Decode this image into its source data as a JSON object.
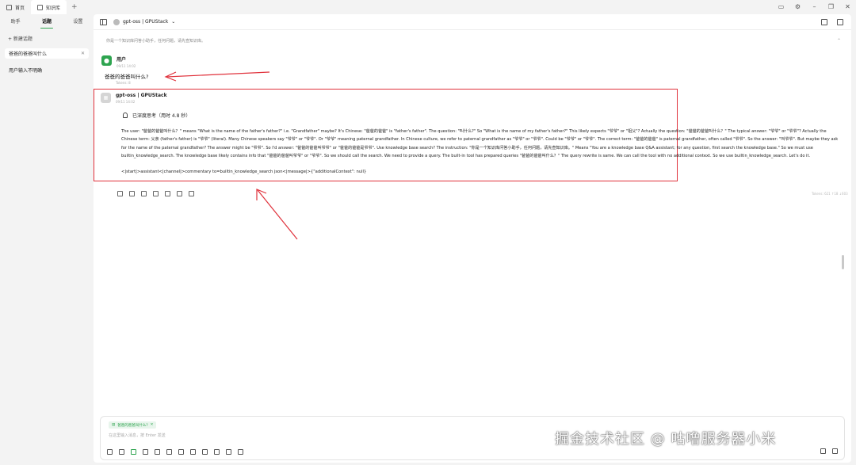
{
  "top_tabs": [
    {
      "label": "首页"
    },
    {
      "label": "知识库"
    }
  ],
  "sidebar": {
    "tabs": [
      {
        "label": "助手"
      },
      {
        "label": "话题"
      },
      {
        "label": "设置"
      }
    ],
    "new_topic": "+ 新建话题",
    "topics": [
      {
        "label": "爸爸的爸爸叫什么"
      },
      {
        "label": "用户输入不明确"
      }
    ]
  },
  "header": {
    "model": "gpt-oss | GPUStack"
  },
  "conversation": {
    "system_prompt": "你是一个知识库问答小助手，任何问题，请先查知识库。",
    "user": {
      "name": "用户",
      "time": "09/11 14:02",
      "text": "爸爸的爸爸叫什么?",
      "tokens": "Tokens: 8"
    },
    "assistant": {
      "name": "gpt-oss | GPUStack",
      "time": "09/11 14:02",
      "thinking_label": "已深度思考（用时 4.8 秒）",
      "thinking_text": "The user: \"爸爸的爸爸叫什么？\" means \"What is the name of the father's father?\" i.e. \"Grandfather\" maybe? It's Chinese: \"爸爸的爸爸\" is \"father's father\". The question: \"叫什么?\" So \"What is the name of my father's father?\" This likely expects \"爷爷\" or \"祖父\"? Actually the question: \"爸爸的爸爸叫什么？\" The typical answer: \"爷爷\" or \"爷爷\"? Actually the Chinese term: 父亲 (father's father) is \"爷爷\" (literal). Many Chinese speakers say \"爷爷\" or \"爷爷\". Or \"爷爷\" meaning paternal grandfather. In Chinese culture, we refer to paternal grandfather as \"爷爷\" or \"爷爷\". Could be \"爷爷\" or \"爷爷\". The correct term: \"爸爸的爸爸\" is paternal grandfather, often called \"爷爷\". So the answer: \"叫爷爷\". But maybe they ask for the name of the paternal grandfather? The answer might be \"爷爷\". So I'd answer: \"爸爸的爸爸叫爷爷\" or \"爸爸的爸爸是爷爷\". Use knowledge base search? The instruction: \"你是一个知识库问答小助手，任何问题，请先查知识库。\" Means \"You are a knowledge base Q&A assistant; for any question, first search the knowledge base.\" So we must use builtin_knowledge_search. The knowledge base likely contains info that \"爸爸的爸爸叫爷爷\" or \"爷爷\". So we should call the search. We need to provide a query. The built-in tool has prepared queries \"爸爸的爸爸叫什么？\" The query rewrite is same. We can call the tool with no additional context. So we use builtin_knowledge_search. Let's do it.",
      "tool_call": "<|start|>assistant<|channel|>commentary to=builtin_knowledge_search json<|message|>{\"additionalContext\": null}",
      "footer_note": "Tokens: 621 ↑18 ↓603"
    }
  },
  "input": {
    "chip": "爸爸的爸爸叫什么?",
    "placeholder": "在这里输入消息，按 Enter 发送"
  },
  "watermark": "掘金技术社区 @ 咕噜服务器小米",
  "colors": {
    "accent": "#2ea44f",
    "highlight_box": "#e0313b",
    "arrow": "#e0313b"
  }
}
